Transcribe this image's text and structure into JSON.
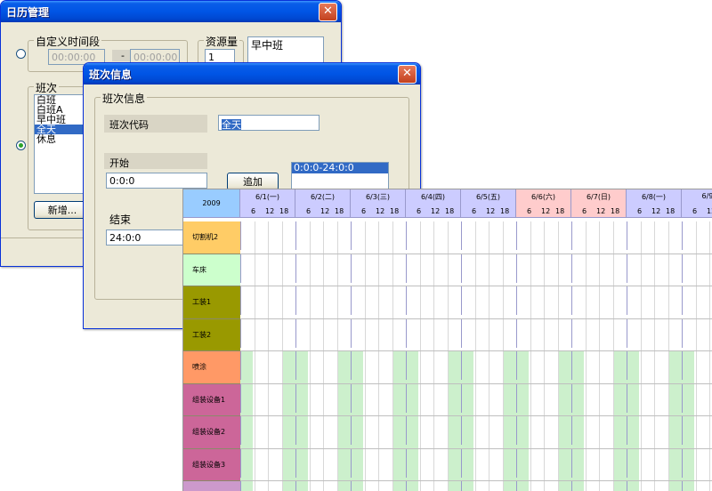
{
  "calendar_window": {
    "title": "日历管理",
    "custom_range_label": "自定义时间段",
    "start_time": "00:00:00",
    "end_time": "00:00:00",
    "separator": "-",
    "resource_qty_label": "资源量",
    "resource_qty_value": "1",
    "shift_preview": "早中班",
    "shift_group_label": "班次",
    "shifts": [
      "白班",
      "白班A",
      "早中班",
      "全天",
      "休息"
    ],
    "selected_shift_index": 3,
    "new_button": "新增..."
  },
  "shift_window": {
    "title": "班次信息",
    "group_label": "班次信息",
    "code_label": "班次代码",
    "code_value": "全天",
    "start_label": "开始",
    "start_value": "0:0:0",
    "end_label": "结束",
    "end_value": "24:0:0",
    "add_button": "追加",
    "intervals": [
      "0:0:0-24:0:0"
    ]
  },
  "gantt": {
    "year": "2009",
    "hour_ticks": [
      "6",
      "12",
      "18"
    ],
    "days": [
      {
        "label": "6/1(一)",
        "color": "#ccccff"
      },
      {
        "label": "6/2(二)",
        "color": "#ccccff"
      },
      {
        "label": "6/3(三)",
        "color": "#ccccff"
      },
      {
        "label": "6/4(四)",
        "color": "#ccccff"
      },
      {
        "label": "6/5(五)",
        "color": "#ccccff"
      },
      {
        "label": "6/6(六)",
        "color": "#ffcccc"
      },
      {
        "label": "6/7(日)",
        "color": "#ffcccc"
      },
      {
        "label": "6/8(一)",
        "color": "#ccccff"
      },
      {
        "label": "6/9(",
        "color": "#ccccff"
      }
    ],
    "resources": [
      {
        "name": "切割机2",
        "color": "#ffcc66",
        "shaded": false
      },
      {
        "name": "车床",
        "color": "#ccffcc",
        "shaded": false
      },
      {
        "name": "工装1",
        "color": "#999900",
        "shaded": false
      },
      {
        "name": "工装2",
        "color": "#999900",
        "shaded": false
      },
      {
        "name": "喷涂",
        "color": "#ff9966",
        "shaded": true
      },
      {
        "name": "组装设备1",
        "color": "#cc6699",
        "shaded": true
      },
      {
        "name": "组装设备2",
        "color": "#cc6699",
        "shaded": true
      },
      {
        "name": "组装设备3",
        "color": "#cc6699",
        "shaded": true
      },
      {
        "name": "",
        "color": "#cc99cc",
        "shaded": true
      }
    ]
  }
}
